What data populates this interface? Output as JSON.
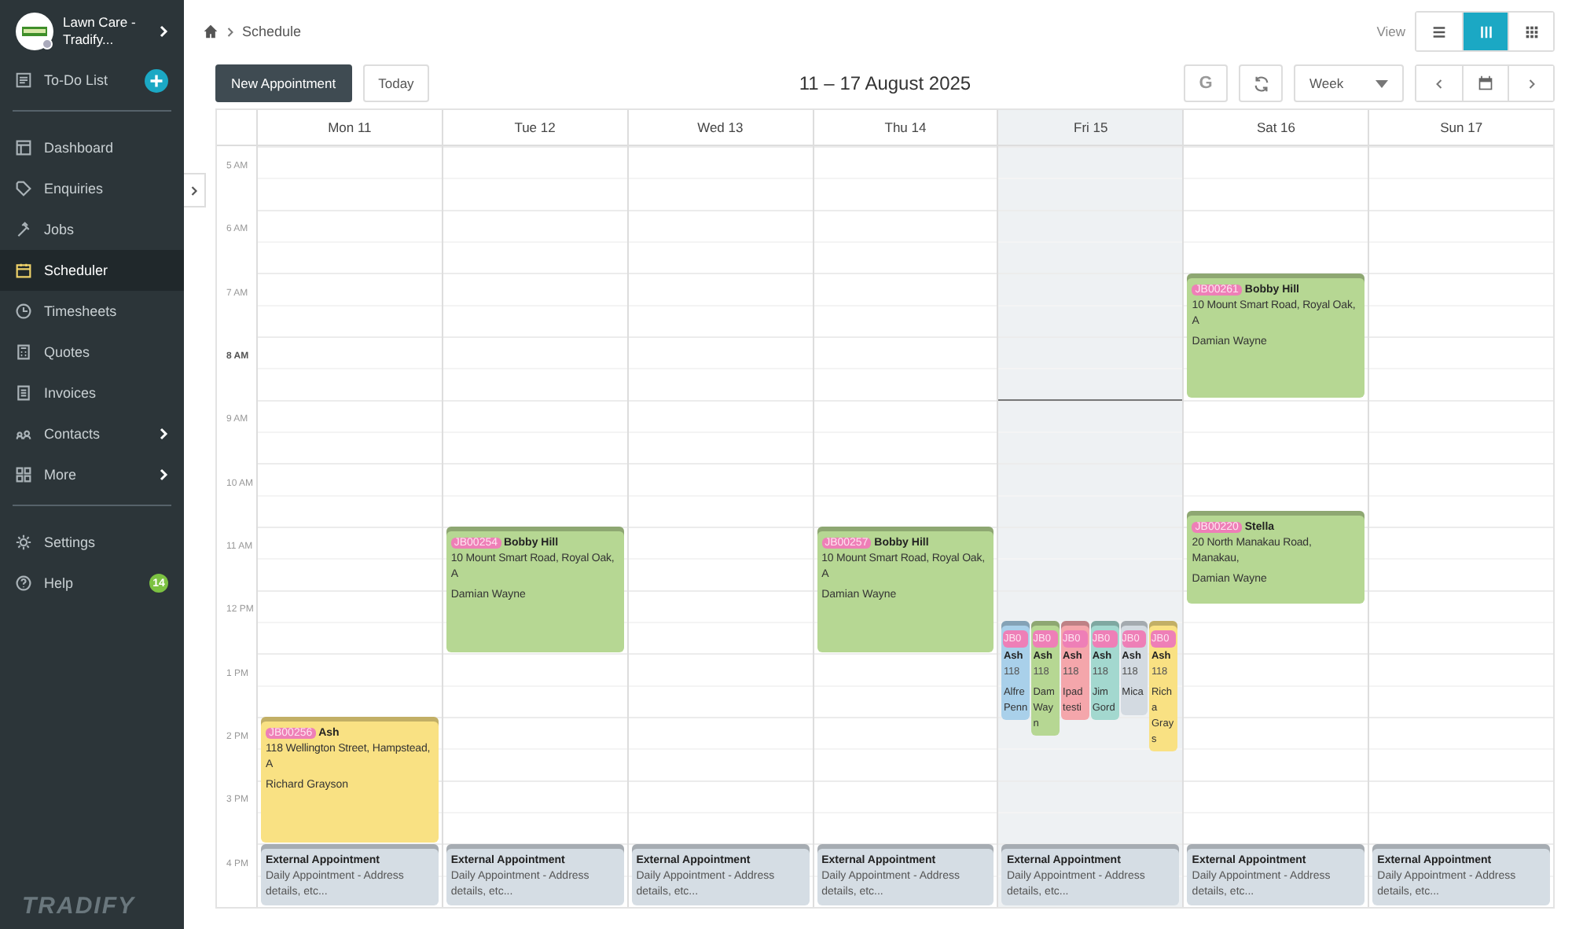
{
  "sidebar": {
    "account": {
      "name": "Lawn Care - Tradify..."
    },
    "todo": {
      "label": "To-Do List"
    },
    "items": [
      {
        "label": "Dashboard",
        "selected": false,
        "expandable": false
      },
      {
        "label": "Enquiries",
        "selected": false,
        "expandable": false
      },
      {
        "label": "Jobs",
        "selected": false,
        "expandable": false
      },
      {
        "label": "Scheduler",
        "selected": true,
        "expandable": false
      },
      {
        "label": "Timesheets",
        "selected": false,
        "expandable": false
      },
      {
        "label": "Quotes",
        "selected": false,
        "expandable": false
      },
      {
        "label": "Invoices",
        "selected": false,
        "expandable": false
      },
      {
        "label": "Contacts",
        "selected": false,
        "expandable": true
      },
      {
        "label": "More",
        "selected": false,
        "expandable": true
      }
    ],
    "footer_items": [
      {
        "label": "Settings"
      },
      {
        "label": "Help",
        "badge": "14"
      }
    ],
    "logo": "TRADIFY"
  },
  "breadcrumb": {
    "current": "Schedule"
  },
  "view": {
    "label": "View",
    "modes": [
      {
        "selected": false
      },
      {
        "selected": true
      },
      {
        "selected": false
      }
    ]
  },
  "toolbar": {
    "new_button": "New Appointment",
    "today_button": "Today",
    "title": "11 – 17 August 2025",
    "google_button": "G",
    "range": "Week"
  },
  "calendar": {
    "hours": [
      {
        "label": "5 AM",
        "current": false
      },
      {
        "label": "6 AM",
        "current": false
      },
      {
        "label": "7 AM",
        "current": false
      },
      {
        "label": "8 AM",
        "current": true
      },
      {
        "label": "9 AM",
        "current": false
      },
      {
        "label": "10 AM",
        "current": false
      },
      {
        "label": "11 AM",
        "current": false
      },
      {
        "label": "12 PM",
        "current": false
      },
      {
        "label": "1 PM",
        "current": false
      },
      {
        "label": "2 PM",
        "current": false
      },
      {
        "label": "3 PM",
        "current": false
      },
      {
        "label": "4 PM",
        "current": false
      }
    ],
    "days": [
      {
        "label": "Mon 11",
        "today": false,
        "events": [
          {
            "kind": "job",
            "ref": "JB00256",
            "name": "Ash",
            "address": "118 Wellington Street, Hampstead, A",
            "staff": "Richard Grayson",
            "color": "#f9e183"
          },
          {
            "kind": "external",
            "name": "External Appointment",
            "details": "Daily Appointment - Address details, etc...",
            "color": "#d5dde4"
          }
        ]
      },
      {
        "label": "Tue 12",
        "today": false,
        "events": [
          {
            "kind": "job",
            "ref": "JB00254",
            "name": "Bobby Hill",
            "address": "10 Mount Smart Road, Royal Oak, A",
            "staff": "Damian Wayne",
            "color": "#b6d793"
          },
          {
            "kind": "external",
            "name": "External Appointment",
            "details": "Daily Appointment - Address details, etc...",
            "color": "#d5dde4"
          }
        ]
      },
      {
        "label": "Wed 13",
        "today": false,
        "events": [
          {
            "kind": "external",
            "name": "External Appointment",
            "details": "Daily Appointment - Address details, etc...",
            "color": "#d5dde4"
          }
        ]
      },
      {
        "label": "Thu 14",
        "today": false,
        "events": [
          {
            "kind": "job",
            "ref": "JB00257",
            "name": "Bobby Hill",
            "address": "10 Mount Smart Road, Royal Oak, A",
            "staff": "Damian Wayne",
            "color": "#b6d793"
          },
          {
            "kind": "external",
            "name": "External Appointment",
            "details": "Daily Appointment - Address details, etc...",
            "color": "#d5dde4"
          }
        ]
      },
      {
        "label": "Fri 15",
        "today": true,
        "events": [
          {
            "kind": "job",
            "ref": "JB0",
            "name": "Ash",
            "address": "118",
            "staff": "Alfre Penn",
            "color": "#a9d0ea"
          },
          {
            "kind": "job",
            "ref": "JB0",
            "name": "Ash",
            "address": "118",
            "staff": "Dam Wayn",
            "color": "#b6d793"
          },
          {
            "kind": "job",
            "ref": "JB0",
            "name": "Ash",
            "address": "118",
            "staff": "Ipad testi",
            "color": "#f4a6ab"
          },
          {
            "kind": "job",
            "ref": "JB0",
            "name": "Ash",
            "address": "118",
            "staff": "Jim Gord",
            "color": "#a3d8cf"
          },
          {
            "kind": "job",
            "ref": "JB0",
            "name": "Ash",
            "address": "118",
            "staff": "Mica",
            "color": "#d3dae1"
          },
          {
            "kind": "job",
            "ref": "JB0",
            "name": "Ash",
            "address": "118",
            "staff": "Richa Grays",
            "color": "#f9e183"
          },
          {
            "kind": "external",
            "name": "External Appointment",
            "details": "Daily Appointment - Address details, etc...",
            "color": "#d5dde4"
          }
        ]
      },
      {
        "label": "Sat 16",
        "today": false,
        "events": [
          {
            "kind": "job",
            "ref": "JB00261",
            "name": "Bobby Hill",
            "address": "10 Mount Smart Road, Royal Oak, A",
            "staff": "Damian Wayne",
            "color": "#b6d793"
          },
          {
            "kind": "job",
            "ref": "JB00220",
            "name": "Stella",
            "address": "20 North Manakau Road, Manakau,",
            "staff": "Damian Wayne",
            "color": "#b6d793"
          },
          {
            "kind": "external",
            "name": "External Appointment",
            "details": "Daily Appointment - Address details, etc...",
            "color": "#d5dde4"
          }
        ]
      },
      {
        "label": "Sun 17",
        "today": false,
        "events": [
          {
            "kind": "external",
            "name": "External Appointment",
            "details": "Daily Appointment - Address details, etc...",
            "color": "#d5dde4"
          }
        ]
      }
    ]
  }
}
